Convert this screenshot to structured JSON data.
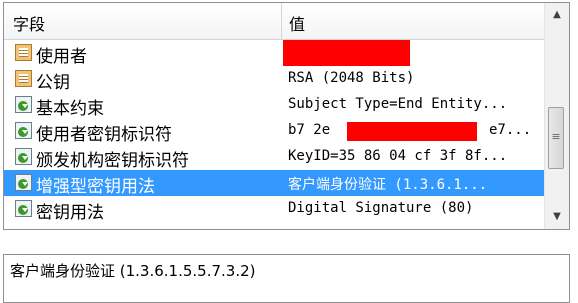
{
  "columns": {
    "field": "字段",
    "value": "值"
  },
  "rows": [
    {
      "field": "使用者",
      "value": "",
      "icon": "document-icon"
    },
    {
      "field": "公钥",
      "value": "RSA (2048 Bits)",
      "icon": "document-icon"
    },
    {
      "field": "基本约束",
      "value": "Subject Type=End Entity...",
      "icon": "extension-icon"
    },
    {
      "field": "使用者密钥标识符",
      "value": "b7 2e",
      "value_tail": "e7...",
      "icon": "extension-icon"
    },
    {
      "field": "颁发机构密钥标识符",
      "value": "KeyID=35 86 04 cf 3f 8f...",
      "icon": "extension-icon"
    },
    {
      "field": "增强型密钥用法",
      "value": "客户端身份验证 (1.3.6.1...",
      "icon": "extension-icon",
      "selected": true
    },
    {
      "field": "密钥用法",
      "value": "Digital Signature (80)",
      "icon": "extension-icon"
    }
  ],
  "scrollbar": {
    "up": "▲",
    "down": "▼",
    "grip": "≡"
  },
  "detail": {
    "text": "客户端身份验证 (1.3.6.1.5.5.7.3.2)"
  },
  "colors": {
    "selection": "#3399ff",
    "redaction": "#ff0000"
  }
}
